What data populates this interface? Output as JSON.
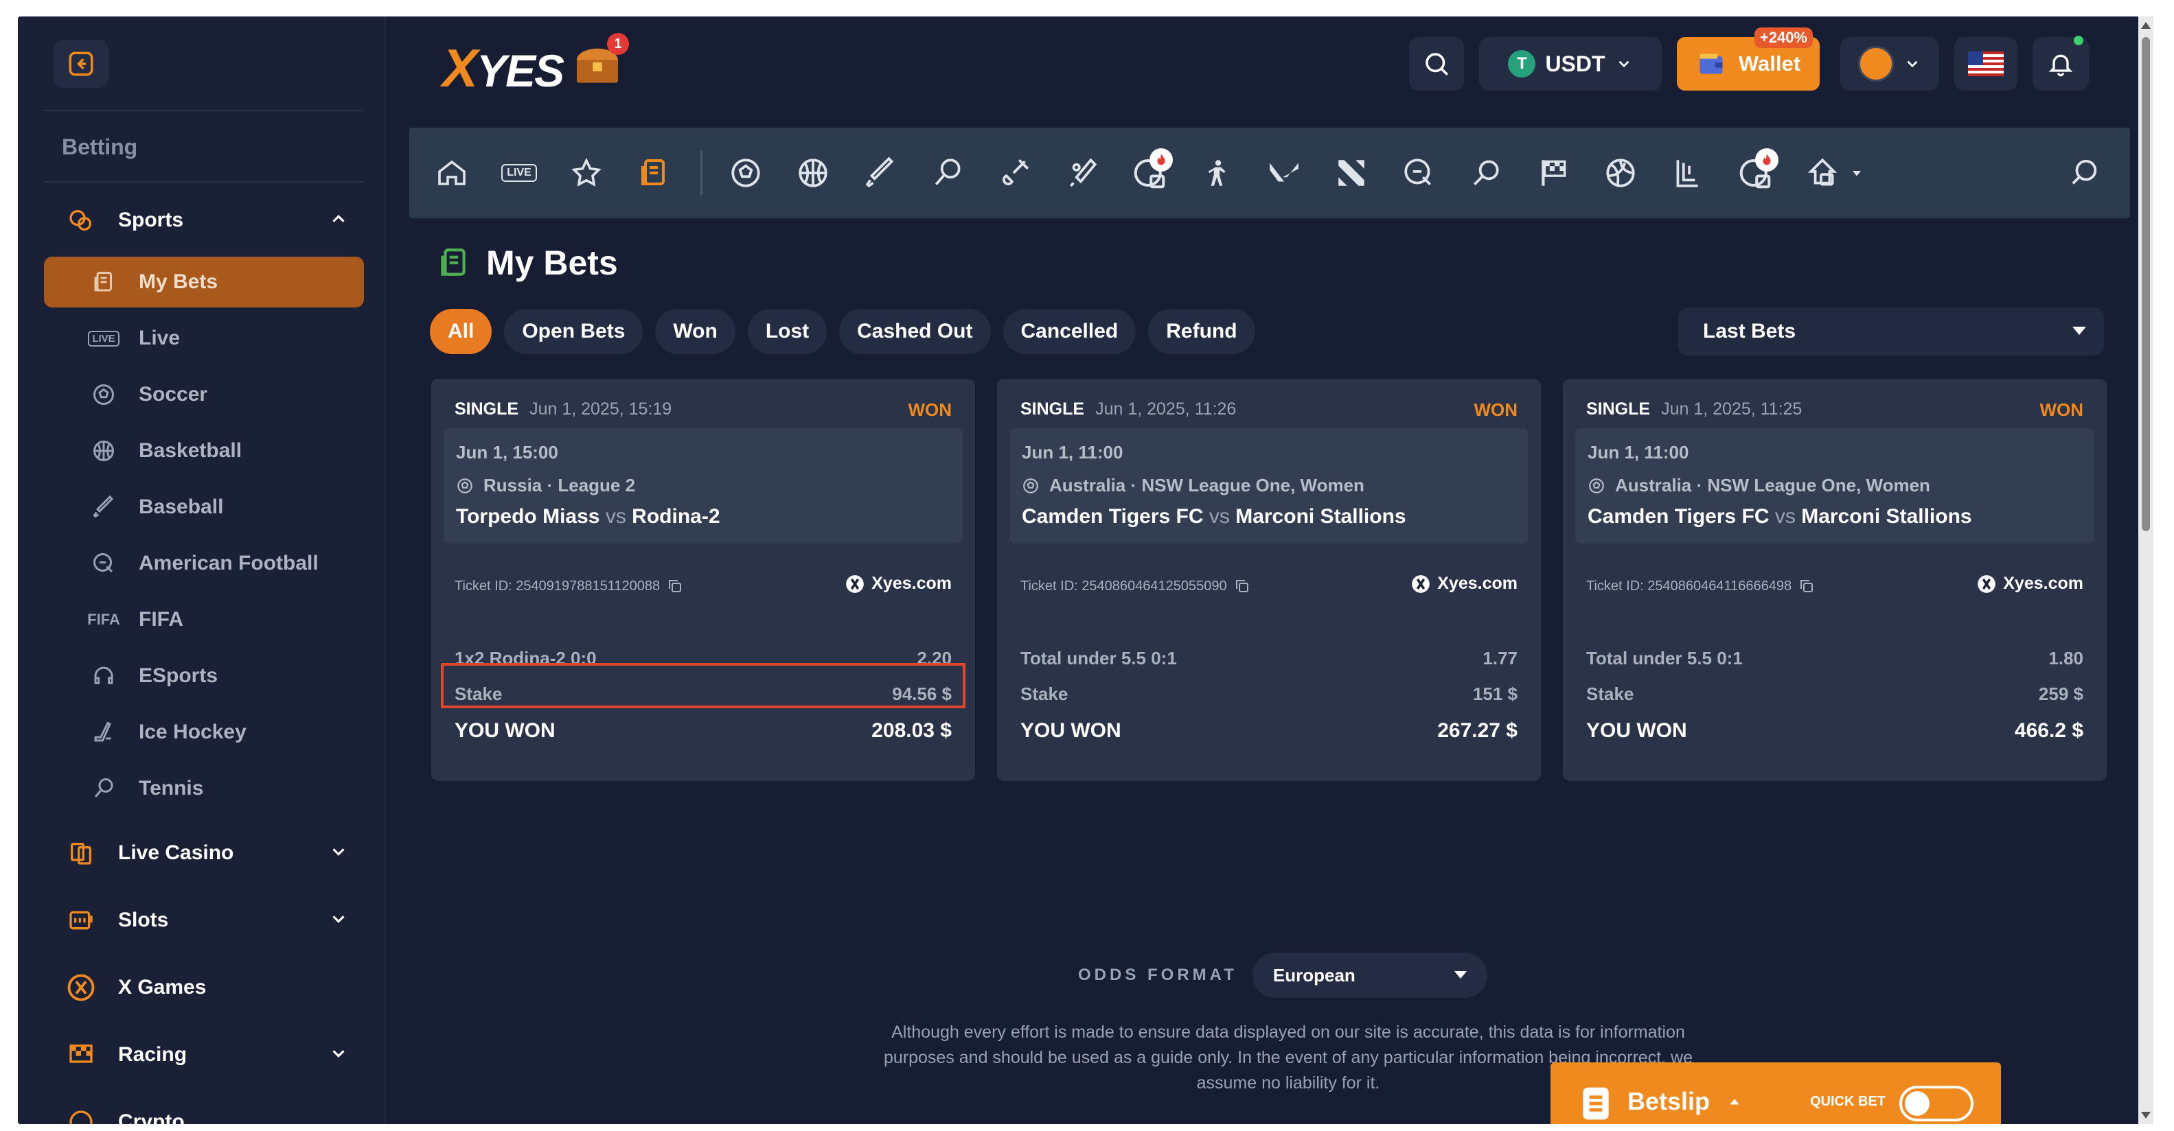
{
  "sidebar": {
    "heading": "Betting",
    "groups": [
      {
        "label": "Sports",
        "icon": "sports-icon"
      },
      {
        "label": "Live Casino",
        "icon": "cards-icon"
      },
      {
        "label": "Slots",
        "icon": "slots-icon"
      },
      {
        "label": "X Games",
        "icon": "xgames-icon"
      },
      {
        "label": "Racing",
        "icon": "checkered-flag-icon"
      },
      {
        "label": "Crypto",
        "icon": "crypto-icon"
      }
    ],
    "items": [
      {
        "label": "My Bets",
        "icon": "mybets-icon",
        "active": true
      },
      {
        "label": "Live",
        "icon": "live-icon",
        "icon_text": "LIVE"
      },
      {
        "label": "Soccer",
        "icon": "soccer-ball-icon"
      },
      {
        "label": "Basketball",
        "icon": "basketball-icon"
      },
      {
        "label": "Baseball",
        "icon": "baseball-bat-icon"
      },
      {
        "label": "American Football",
        "icon": "american-football-icon"
      },
      {
        "label": "FIFA",
        "icon": "fifa-icon",
        "icon_text": "FIFA"
      },
      {
        "label": "ESports",
        "icon": "headset-icon"
      },
      {
        "label": "Ice Hockey",
        "icon": "hockey-stick-icon"
      },
      {
        "label": "Tennis",
        "icon": "tennis-racket-icon"
      }
    ]
  },
  "header": {
    "logo_x": "X",
    "logo_rest": "YES",
    "chest_badge": "1",
    "currency": "USDT",
    "currency_symbol": "T",
    "wallet_label": "Wallet",
    "wallet_bonus": "+240%"
  },
  "nav_icons": [
    "home-icon",
    "live-icon",
    "star-icon",
    "mybets-icon",
    "soccer-icon",
    "basketball-icon",
    "baseball-icon",
    "tennis-icon",
    "badminton-icon",
    "cricket-icon",
    "world-cup-icon",
    "counter-strike-icon",
    "valorant-icon",
    "dota-icon",
    "american-football-icon",
    "table-tennis-icon",
    "racing-flag-icon",
    "volleyball-icon",
    "lol-icon",
    "fifa-icon",
    "hockey-icon",
    "search-icon"
  ],
  "page": {
    "title": "My Bets",
    "filters": [
      "All",
      "Open Bets",
      "Won",
      "Lost",
      "Cashed Out",
      "Cancelled",
      "Refund"
    ],
    "active_filter": "All",
    "sort": "Last Bets"
  },
  "bets": [
    {
      "type": "SINGLE",
      "date": "Jun 1, 2025, 15:19",
      "status": "WON",
      "event_time": "Jun 1, 15:00",
      "league": "Russia · League 2",
      "home": "Torpedo Miass",
      "vs": "vs",
      "away": "Rodina-2",
      "ticket": "Ticket ID: 2540919788151120088",
      "brand": "Xyes.com",
      "selection": "1x2 Rodina-2  0:0",
      "odds": "2.20",
      "stake_label": "Stake",
      "stake": "94.56 $",
      "won_label": "YOU WON",
      "won": "208.03 $"
    },
    {
      "type": "SINGLE",
      "date": "Jun 1, 2025, 11:26",
      "status": "WON",
      "event_time": "Jun 1, 11:00",
      "league": "Australia · NSW League One, Women",
      "home": "Camden Tigers FC",
      "vs": "vs",
      "away": "Marconi Stallions",
      "ticket": "Ticket ID: 2540860464125055090",
      "brand": "Xyes.com",
      "selection": "Total under 5.5  0:1",
      "odds": "1.77",
      "stake_label": "Stake",
      "stake": "151 $",
      "won_label": "YOU WON",
      "won": "267.27 $"
    },
    {
      "type": "SINGLE",
      "date": "Jun 1, 2025, 11:25",
      "status": "WON",
      "event_time": "Jun 1, 11:00",
      "league": "Australia · NSW League One, Women",
      "home": "Camden Tigers FC",
      "vs": "vs",
      "away": "Marconi Stallions",
      "ticket": "Ticket ID: 2540860464116666498",
      "brand": "Xyes.com",
      "selection": "Total under 5.5  0:1",
      "odds": "1.80",
      "stake_label": "Stake",
      "stake": "259 $",
      "won_label": "YOU WON",
      "won": "466.2 $"
    }
  ],
  "odds_format": {
    "label": "ODDS FORMAT",
    "value": "European"
  },
  "disclaimer": "Although every effort is made to ensure data displayed on our site is accurate, this data is for information purposes and should be used as a guide only. In the event of any particular information being incorrect, we assume no liability for it.",
  "betslip": {
    "label": "Betslip",
    "quick_bet": "QUICK BET"
  },
  "colors": {
    "accent": "#f08a1e",
    "background": "#171d33",
    "card": "#2a3347",
    "highlight": "#e0462c"
  }
}
